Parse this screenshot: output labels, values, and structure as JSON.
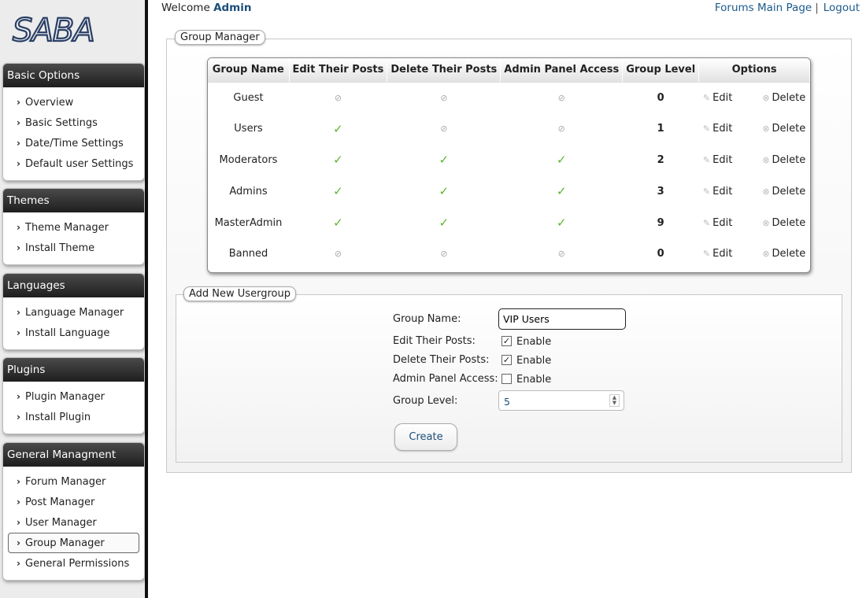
{
  "logo": {
    "text": "SABA"
  },
  "sidebar": {
    "sections": [
      {
        "title": "Basic Options",
        "items": [
          "Overview",
          "Basic Settings",
          "Date/Time Settings",
          "Default user Settings"
        ]
      },
      {
        "title": "Themes",
        "items": [
          "Theme Manager",
          "Install Theme"
        ]
      },
      {
        "title": "Languages",
        "items": [
          "Language Manager",
          "Install Language"
        ]
      },
      {
        "title": "Plugins",
        "items": [
          "Plugin Manager",
          "Install Plugin"
        ]
      },
      {
        "title": "General Managment",
        "items": [
          "Forum Manager",
          "Post Manager",
          "User Manager",
          "Group Manager",
          "General Permissions"
        ]
      }
    ],
    "active_item": "Group Manager"
  },
  "header": {
    "welcome": "Welcome",
    "username": "Admin",
    "links": [
      "Forums Main Page",
      "Logout"
    ],
    "separator": "|"
  },
  "group_manager": {
    "legend": "Group Manager",
    "columns": [
      "Group Name",
      "Edit Their Posts",
      "Delete Their Posts",
      "Admin Panel Access",
      "Group Level",
      "Options"
    ],
    "edit_label": "Edit",
    "delete_label": "Delete",
    "rows": [
      {
        "name": "Guest",
        "edit": false,
        "delete": false,
        "admin": false,
        "level": "0"
      },
      {
        "name": "Users",
        "edit": true,
        "delete": false,
        "admin": false,
        "level": "1"
      },
      {
        "name": "Moderators",
        "edit": true,
        "delete": true,
        "admin": true,
        "level": "2"
      },
      {
        "name": "Admins",
        "edit": true,
        "delete": true,
        "admin": true,
        "level": "3"
      },
      {
        "name": "MasterAdmin",
        "edit": true,
        "delete": true,
        "admin": true,
        "level": "9"
      },
      {
        "name": "Banned",
        "edit": false,
        "delete": false,
        "admin": false,
        "level": "0"
      }
    ]
  },
  "add_group": {
    "legend": "Add New Usergroup",
    "name_label": "Group Name:",
    "name_value": "VIP Users",
    "edit_label": "Edit Their Posts:",
    "delete_label": "Delete Their Posts:",
    "admin_label": "Admin Panel Access:",
    "enable_label": "Enable",
    "edit_checked": true,
    "delete_checked": true,
    "admin_checked": false,
    "level_label": "Group Level:",
    "level_value": "5",
    "create_label": "Create"
  },
  "colors": {
    "accent": "#1c4f7a",
    "check": "#5ab52b",
    "header_dark": "#1e1e1e"
  }
}
